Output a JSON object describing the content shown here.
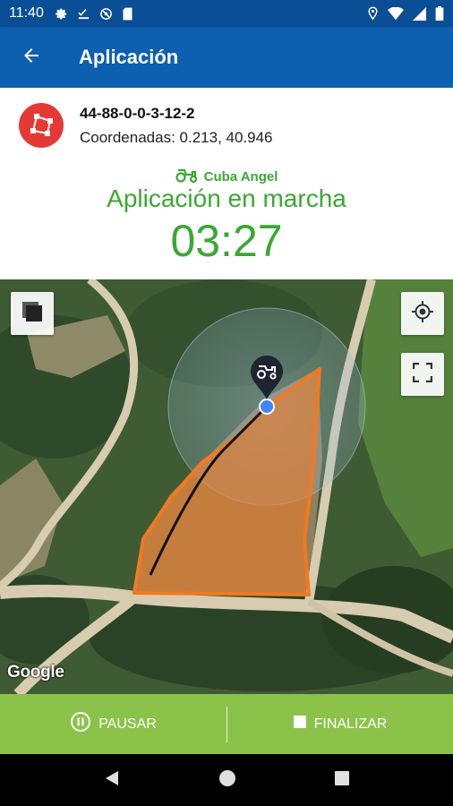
{
  "status_bar": {
    "time": "11:40",
    "left_icons": [
      "gear-icon",
      "checklist-icon",
      "no-tracking-icon",
      "sd-card-icon"
    ],
    "right_icons": [
      "location-pin-icon",
      "wifi-icon",
      "signal-icon",
      "battery-icon"
    ]
  },
  "app_bar": {
    "title": "Aplicación",
    "back_icon": "arrow-left-icon",
    "color": "#0d5fb0"
  },
  "field": {
    "icon": "polygon-field-icon",
    "id": "44-88-0-0-3-12-2",
    "coordinates": "Coordenadas: 0.213, 40.946"
  },
  "machine": {
    "icon": "tractor-icon",
    "name": "Cuba Angel"
  },
  "application": {
    "status": "Aplicación en marcha",
    "elapsed": "03:27",
    "accent_color": "#3aa832"
  },
  "map": {
    "attribution": "Google",
    "controls": [
      "layers-icon",
      "my-location-icon",
      "fullscreen-icon"
    ],
    "marker_icon": "tractor-marker-icon",
    "area_color": "#f07a20"
  },
  "actions": {
    "pause_label": "PAUSAR",
    "finish_label": "FINALIZAR",
    "pause_icon": "pause-circle-icon",
    "finish_icon": "stop-square-icon",
    "bar_color": "#8bc34a"
  },
  "nav": {
    "icons": [
      "back-triangle-icon",
      "home-circle-icon",
      "recents-square-icon"
    ]
  }
}
